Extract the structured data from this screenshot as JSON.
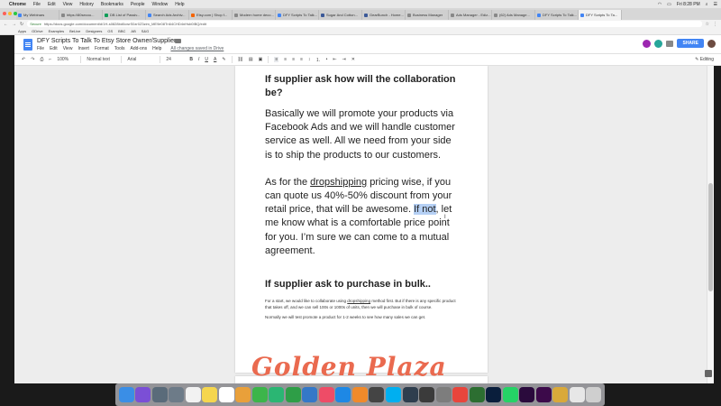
{
  "menubar": {
    "items": [
      "Chrome",
      "File",
      "Edit",
      "View",
      "History",
      "Bookmarks",
      "People",
      "Window",
      "Help"
    ],
    "clock": "Fri 8:28 PM"
  },
  "tabs": [
    {
      "label": "My Webinars",
      "color": "#4285f4"
    },
    {
      "label": "https://80secoo...",
      "color": "#888888"
    },
    {
      "label": "DB List of Passiv...",
      "color": "#0f9d58"
    },
    {
      "label": "Search Ads Archiv...",
      "color": "#4285f4"
    },
    {
      "label": "Etsy.com | Shop f...",
      "color": "#f56400"
    },
    {
      "label": "Modern home deco...",
      "color": "#888888"
    },
    {
      "label": "DFY Scripts To Talk...",
      "color": "#4285f4"
    },
    {
      "label": "Sugar And Cotton...",
      "color": "#3b5998"
    },
    {
      "label": "GearBunch - Home...",
      "color": "#3b5998"
    },
    {
      "label": "Business Manager",
      "color": "#888888"
    },
    {
      "label": "Ads Manager - Ediz...",
      "color": "#888888"
    },
    {
      "label": "(62) Ads Manage...",
      "color": "#888888"
    },
    {
      "label": "DFY Scripts To Talk...",
      "color": "#4285f4"
    },
    {
      "label": "DFY Scripts To Ta...",
      "color": "#4285f4"
    }
  ],
  "address": {
    "secure": "Secure",
    "url": "https://docs.google.com/document/d/1H-s0828bd0cwrS0zr0Z3zim_ME9e08Tn64CHD4nHsb0IBQ/edit"
  },
  "bookmarks": [
    "Apps",
    "GDrive",
    "Examples",
    "BeLive",
    "Designers",
    "GS",
    "BBC",
    "AB",
    "S&G"
  ],
  "doc": {
    "title": "DFY Scripts To Talk To Etsy Store Owner/Supplier",
    "menu": [
      "File",
      "Edit",
      "View",
      "Insert",
      "Format",
      "Tools",
      "Add-ons",
      "Help"
    ],
    "saved": "All changes saved in Drive",
    "share": "SHARE"
  },
  "toolbar": {
    "zoom": "100%",
    "style": "Normal text",
    "font": "Arial",
    "size": "24",
    "bold": "B",
    "italic": "I",
    "underline": "U",
    "text_color": "A",
    "mode": "Editing"
  },
  "content": {
    "heading1": "If supplier ask how will the collaboration be?",
    "para1": "Basically we will promote your products via Facebook Ads and we will handle customer service as well. All we need from your side is to ship the products to our customers.",
    "para2_a": "As for the ",
    "para2_link": "dropshipping",
    "para2_b": " pricing wise, if you can quote us 40%-50% discount from your retail price, that will be awesome. ",
    "para2_hl": "If not",
    "para2_c": ", let me know what is a comfortable price point for you. I’m sure we can come to a mutual agreement.",
    "heading2": "If supplier ask to purchase in bulk..",
    "small1_a": "For a start, we would like to collaborate using ",
    "small1_link": "dropshipping",
    "small1_b": " method first. But if there is any specific product that takes off, and we can sell 100s or 1000s of units, then we will purchase in bulk of course.",
    "small2": "Normally we will test promote a product for 1-2 weeks to see how many sales we can get."
  },
  "watermark": "Golden Plaza",
  "dock": [
    {
      "name": "finder",
      "color": "#3a8ee6"
    },
    {
      "name": "siri",
      "color": "#7b4fd6"
    },
    {
      "name": "launchpad",
      "color": "#5a6b7a"
    },
    {
      "name": "rocket",
      "color": "#6d7b88"
    },
    {
      "name": "calendar",
      "color": "#f2f2f2"
    },
    {
      "name": "notes",
      "color": "#f5d64e"
    },
    {
      "name": "reminders",
      "color": "#ffffff"
    },
    {
      "name": "photos",
      "color": "#e9a03a"
    },
    {
      "name": "facetime",
      "color": "#3cb54a"
    },
    {
      "name": "messages",
      "color": "#2bb673"
    },
    {
      "name": "numbers",
      "color": "#2e9e47"
    },
    {
      "name": "keynote",
      "color": "#3478c8"
    },
    {
      "name": "music",
      "color": "#ee4c67"
    },
    {
      "name": "app-store",
      "color": "#1e88e5"
    },
    {
      "name": "books",
      "color": "#f08a2b"
    },
    {
      "name": "screenflow",
      "color": "#444444"
    },
    {
      "name": "skype",
      "color": "#00aff0"
    },
    {
      "name": "quicktime",
      "color": "#2f3e4e"
    },
    {
      "name": "scrivener",
      "color": "#3b3b3b"
    },
    {
      "name": "system-preferences",
      "color": "#7d7d7d"
    },
    {
      "name": "chrome",
      "color": "#e8453c"
    },
    {
      "name": "camtasia",
      "color": "#2c6e31"
    },
    {
      "name": "photoshop",
      "color": "#0a1e3c"
    },
    {
      "name": "whatsapp",
      "color": "#25d366"
    },
    {
      "name": "premiere",
      "color": "#2a0a3c"
    },
    {
      "name": "premiere-2",
      "color": "#3c0a4a"
    },
    {
      "name": "sunflower",
      "color": "#d9a93a"
    },
    {
      "name": "preview",
      "color": "#e7e7e7"
    },
    {
      "name": "trash",
      "color": "#cfcfcf"
    }
  ]
}
